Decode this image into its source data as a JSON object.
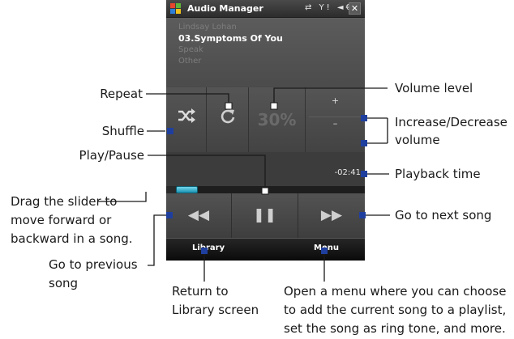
{
  "app": {
    "title": "Audio Manager",
    "status_icons": "⇄ Y! ◄€",
    "close_label": "✕"
  },
  "now_playing": {
    "artist": "Lindsay Lohan",
    "song": "03.Symptoms Of You",
    "album": "Speak",
    "genre": "Other"
  },
  "controls": {
    "shuffle_icon": "shuffle-icon",
    "repeat_icon": "repeat-icon",
    "volume_percent": "30%",
    "volume_plus": "+",
    "volume_minus": "–",
    "playback_time": "-02:41",
    "progress_fraction": 0.05
  },
  "softkeys": {
    "left": "Library",
    "right": "Menu"
  },
  "callouts": {
    "repeat": "Repeat",
    "shuffle": "Shuffle",
    "play_pause": "Play/Pause",
    "slider": [
      "Drag the slider to",
      "move forward or",
      "backward in a song."
    ],
    "previous": [
      "Go to previous",
      "song"
    ],
    "volume_level": "Volume level",
    "increase_decrease": [
      "Increase/Decrease",
      "volume"
    ],
    "playback_time": "Playback time",
    "next_song": "Go to next song",
    "library": [
      "Return to",
      "Library screen"
    ],
    "menu": [
      "Open a menu where you can choose",
      "to add the current song to a playlist,",
      "set the song as ring tone, and more."
    ]
  },
  "colors": {
    "slider_thumb": "#3fb4d2",
    "callout_line": "#1f3f9f",
    "screen_background": "#3f3f3f"
  }
}
